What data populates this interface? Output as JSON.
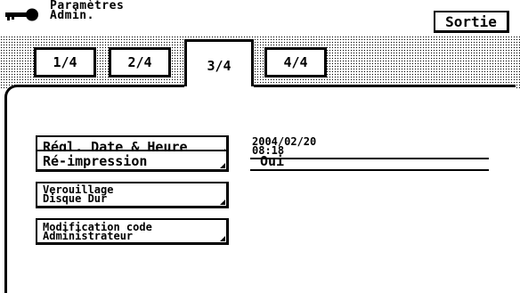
{
  "header": {
    "title_line1": "Paramètres",
    "title_line2": "Admin.",
    "exit_label": "Sortie",
    "icon": "key-icon"
  },
  "tabs": [
    {
      "label": "1/4",
      "active": false
    },
    {
      "label": "2/4",
      "active": false
    },
    {
      "label": "3/4",
      "active": true
    },
    {
      "label": "4/4",
      "active": false
    }
  ],
  "settings": {
    "date_time_button": "Régl. Date & Heure",
    "date_value": "2004/02/20",
    "time_value": "08:18",
    "reprint_button": "Ré-impression",
    "reprint_value": "Oui",
    "hdd_lock_line1": "Verouillage",
    "hdd_lock_line2": "Disque Dur",
    "admin_code_line1": "Modification code",
    "admin_code_line2": "Administrateur"
  }
}
